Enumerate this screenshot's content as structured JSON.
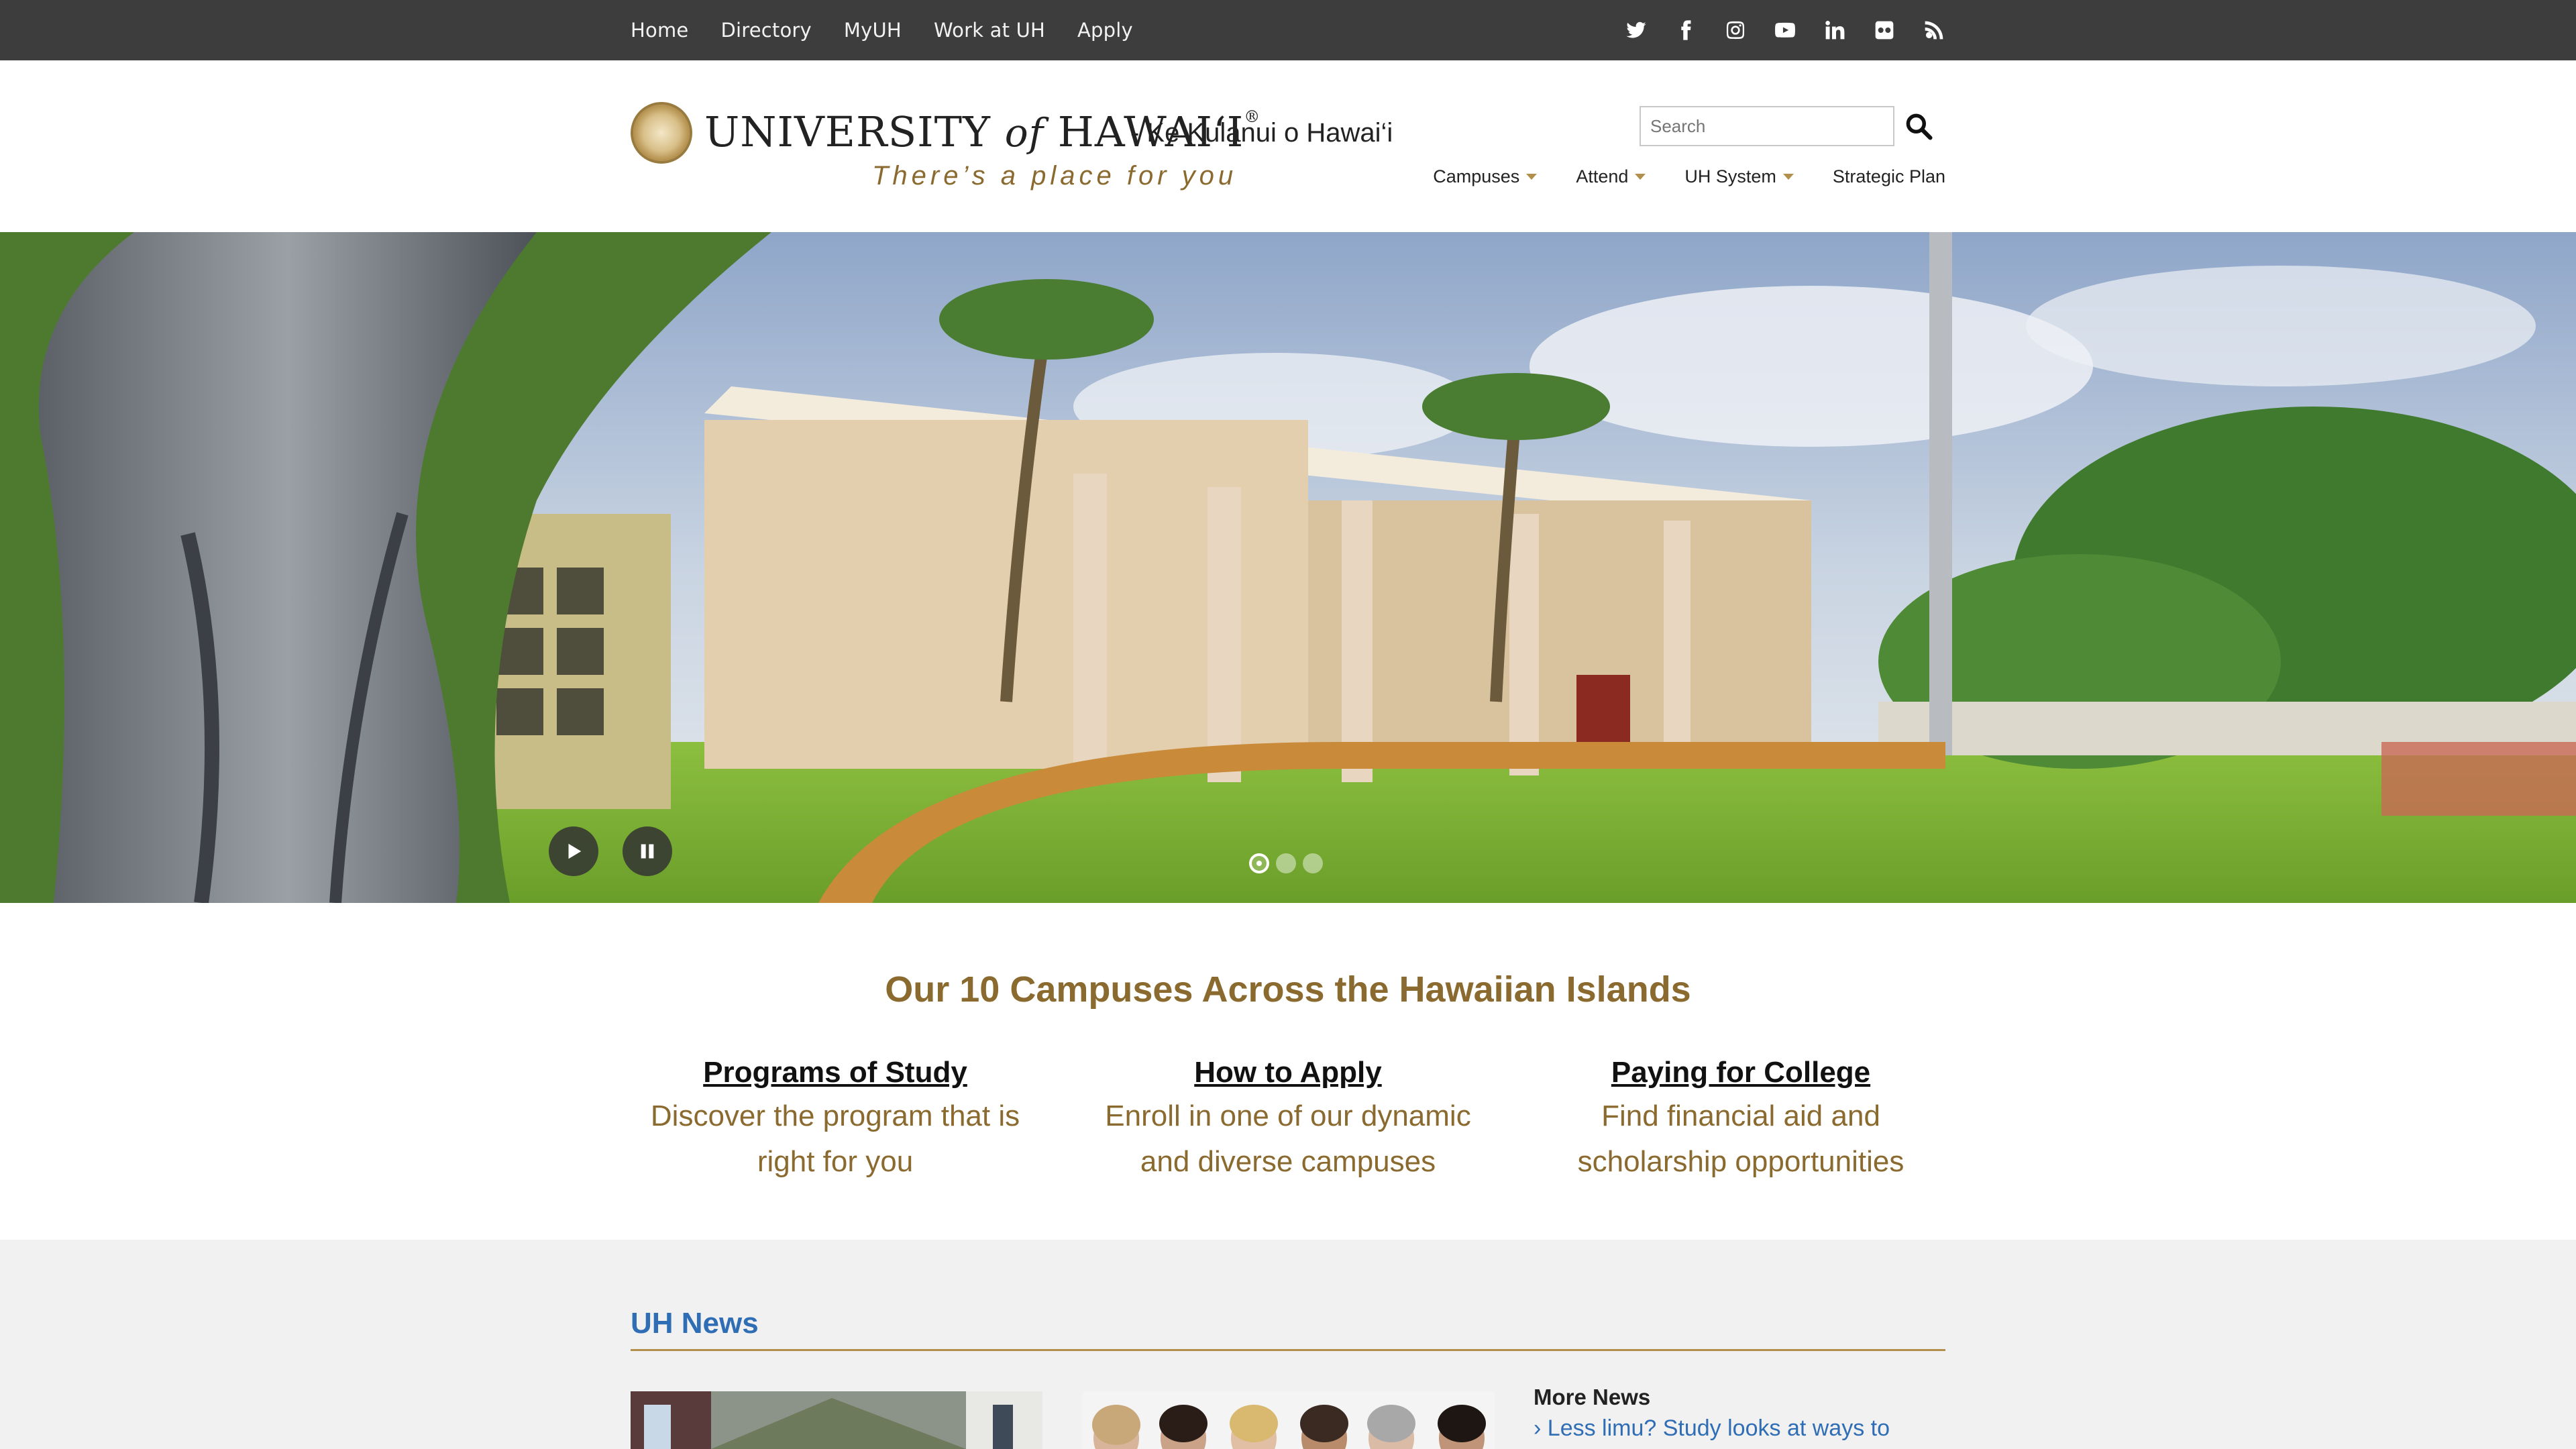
{
  "topnav": {
    "links": [
      "Home",
      "Directory",
      "MyUH",
      "Work at UH",
      "Apply"
    ],
    "social_icons": [
      "twitter-icon",
      "facebook-icon",
      "instagram-icon",
      "youtube-icon",
      "linkedin-icon",
      "flickr-icon",
      "rss-icon"
    ]
  },
  "header": {
    "logo_name_1": "UNIVERSITY",
    "logo_name_of": "of",
    "logo_name_2": "HAWAI‘I",
    "logo_reg": "®",
    "logo_sub": "- Ke Kulanui o Hawai‘i",
    "tagline": "There’s a place for you",
    "search_placeholder": "Search",
    "nav": [
      "Campuses",
      "Attend",
      "UH System",
      "Strategic Plan"
    ]
  },
  "hero": {
    "slide_count": 3,
    "active_slide": 1
  },
  "campuses": {
    "title": "Our 10 Campuses Across the Hawaiian Islands",
    "columns": [
      {
        "heading": "Programs of Study",
        "text": "Discover the program that is right for you"
      },
      {
        "heading": "How to Apply",
        "text": "Enroll in one of our dynamic and diverse campuses"
      },
      {
        "heading": "Paying for College",
        "text": "Find financial aid and scholarship opportunities"
      }
    ]
  },
  "news": {
    "title": "UH News",
    "more_heading": "More News",
    "first_link": "Less limu? Study looks at ways to"
  },
  "colors": {
    "topbar": "#3d3d3d",
    "gold": "#8a6a2f",
    "link_blue": "#2f6db5"
  }
}
